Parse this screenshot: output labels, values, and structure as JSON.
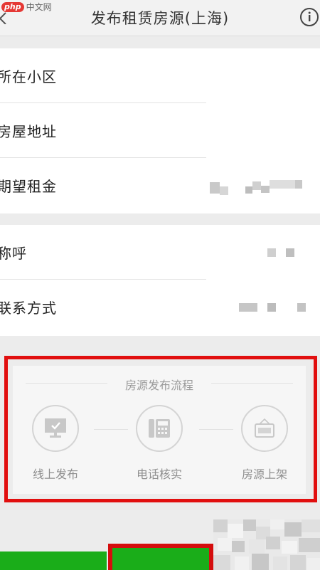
{
  "watermark": {
    "badge": "php",
    "site": "中文网"
  },
  "header": {
    "title": "发布租赁房源(上海)"
  },
  "form": {
    "fields": [
      {
        "label": "所在小区"
      },
      {
        "label": "房屋地址"
      },
      {
        "label": "期望租金"
      }
    ],
    "contact_fields": [
      {
        "label": "称呼"
      },
      {
        "label": "联系方式"
      }
    ]
  },
  "process": {
    "title": "房源发布流程",
    "steps": [
      {
        "label": "线上发布",
        "icon": "monitor-check-icon"
      },
      {
        "label": "电话核实",
        "icon": "telephone-icon"
      },
      {
        "label": "房源上架",
        "icon": "sale-sign-icon"
      }
    ]
  },
  "colors": {
    "accent": "#1aad19",
    "highlight": "#e10f0f",
    "background": "#ececec"
  }
}
